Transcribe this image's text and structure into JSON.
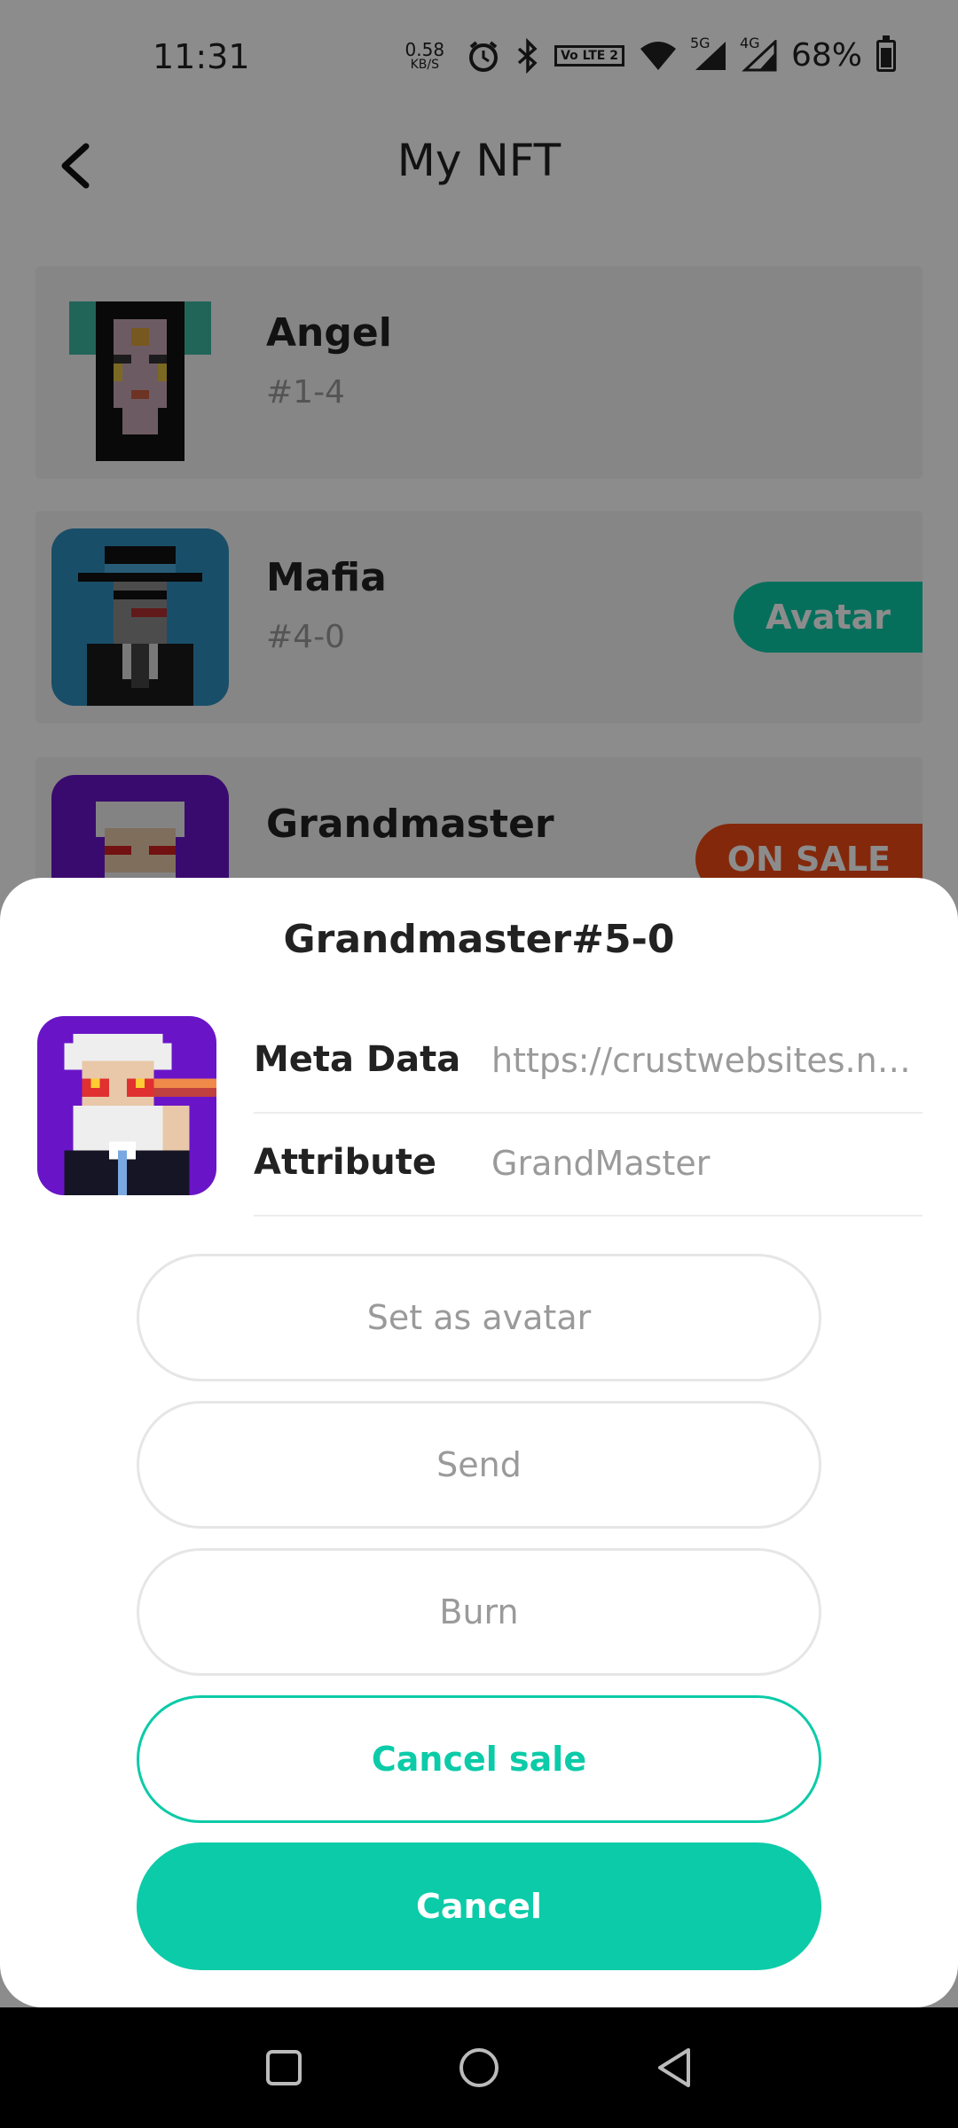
{
  "status_bar": {
    "time": "11:31",
    "net_speed_value": "0.58",
    "net_speed_unit": "KB/S",
    "volte_label": "Vo LTE 2",
    "signal_5g": "5G",
    "signal_4g": "4G",
    "battery_percent": "68%",
    "icons": [
      "alarm-icon",
      "bluetooth-icon",
      "volte-icon",
      "wifi-icon",
      "signal-5g-icon",
      "signal-4g-icon",
      "battery-icon"
    ]
  },
  "header": {
    "title": "My NFT",
    "back_icon": "chevron-left-icon"
  },
  "nft_list": [
    {
      "name": "Angel",
      "id": "#1-4",
      "tag": ""
    },
    {
      "name": "Mafia",
      "id": "#4-0",
      "tag": "Avatar"
    },
    {
      "name": "Grandmaster",
      "id": "",
      "tag": "ON SALE"
    }
  ],
  "sheet": {
    "title": "Grandmaster#5-0",
    "rows": [
      {
        "label": "Meta Data",
        "value": "https://crustwebsites.net/ipfs/..."
      },
      {
        "label": "Attribute",
        "value": "GrandMaster"
      }
    ],
    "buttons": {
      "set_avatar": "Set as avatar",
      "send": "Send",
      "burn": "Burn",
      "cancel_sale": "Cancel sale",
      "cancel": "Cancel"
    }
  },
  "colors": {
    "accent": "#0ccba8",
    "sale": "#ef4a14",
    "muted_text": "#9a9a9a"
  },
  "nav_bar": {
    "icons": [
      "square-recent-icon",
      "circle-home-icon",
      "triangle-back-icon"
    ]
  }
}
